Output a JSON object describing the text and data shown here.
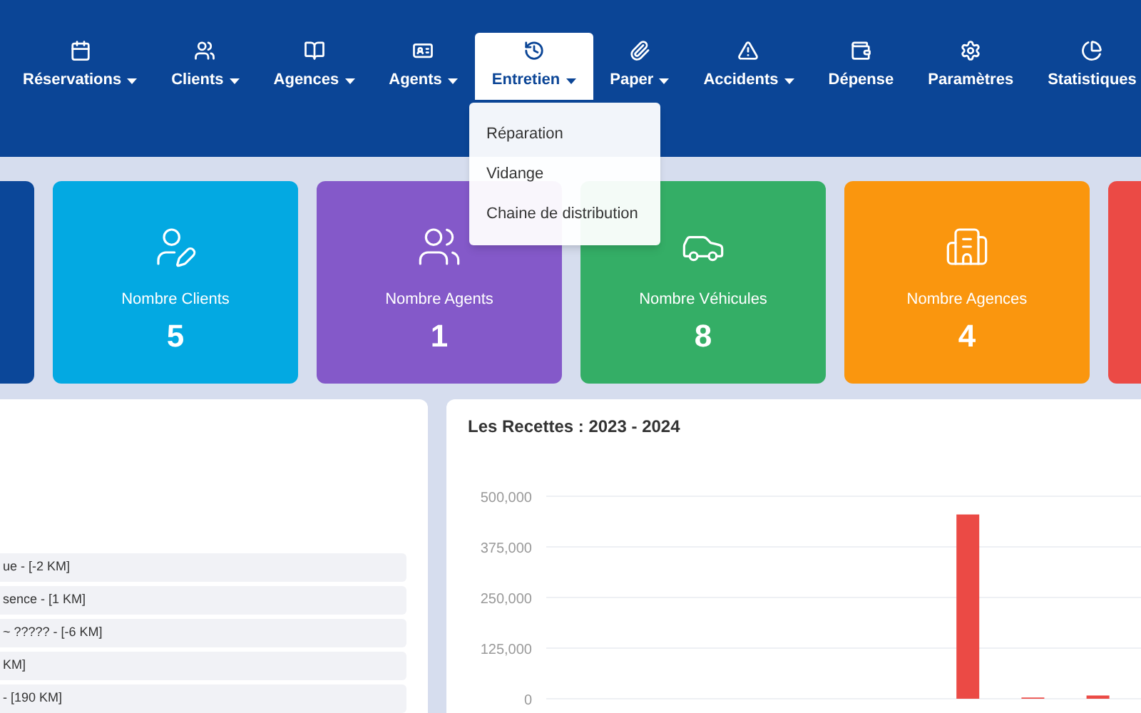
{
  "nav": [
    {
      "label": "Réservations",
      "dropdown": true,
      "selected": false
    },
    {
      "label": "Clients",
      "dropdown": true,
      "selected": false
    },
    {
      "label": "Agences",
      "dropdown": true,
      "selected": false
    },
    {
      "label": "Agents",
      "dropdown": true,
      "selected": false
    },
    {
      "label": "Entretien",
      "dropdown": true,
      "selected": true
    },
    {
      "label": "Paper",
      "dropdown": true,
      "selected": false
    },
    {
      "label": "Accidents",
      "dropdown": true,
      "selected": false
    },
    {
      "label": "Dépense",
      "dropdown": false,
      "selected": false
    },
    {
      "label": "Paramètres",
      "dropdown": false,
      "selected": false
    },
    {
      "label": "Statistiques",
      "dropdown": false,
      "selected": false
    }
  ],
  "dropdown_menu": {
    "items": [
      "Réparation",
      "Vidange",
      "Chaine de distribution"
    ]
  },
  "cards": [
    {
      "kind": "clipped",
      "color": "#0b4799"
    },
    {
      "kind": "stat",
      "color": "#03a9e2",
      "label": "Nombre Clients",
      "value": "5"
    },
    {
      "kind": "stat",
      "color": "#8459c9",
      "label": "Nombre Agents",
      "value": "1"
    },
    {
      "kind": "stat",
      "color": "#34ae66",
      "label": "Nombre Véhicules",
      "value": "8"
    },
    {
      "kind": "stat",
      "color": "#fa960e",
      "label": "Nombre Agences",
      "value": "4"
    },
    {
      "kind": "clipped",
      "color": "#eb4a45"
    }
  ],
  "trips": [
    "ue - [-2 KM]",
    "sence - [1 KM]",
    "~ ????? - [-6 KM]",
    "KM]",
    "- [190 KM]"
  ],
  "revenue": {
    "title": "Les Recettes : 2023 - 2024",
    "chart_data": {
      "type": "bar",
      "grid": true,
      "ylim": [
        0,
        500000
      ],
      "yticks": [
        {
          "value": 0,
          "label": "0"
        },
        {
          "value": 125000,
          "label": "125,000"
        },
        {
          "value": 250000,
          "label": "250,000"
        },
        {
          "value": 375000,
          "label": "375,000"
        },
        {
          "value": 500000,
          "label": "500,000"
        }
      ],
      "series": [
        {
          "color": "#eb4a45",
          "values": [
            null,
            null,
            null,
            null,
            null,
            null,
            455000,
            3000,
            8000
          ]
        }
      ]
    }
  }
}
